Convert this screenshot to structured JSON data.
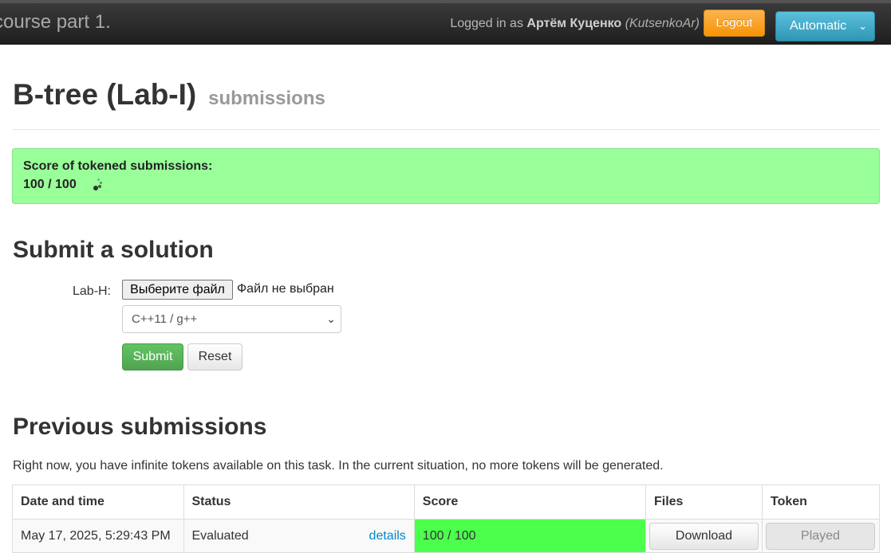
{
  "navbar": {
    "brand": "course part 1.",
    "logged_in_prefix": "Logged in as",
    "user_name": "Артём Куценко",
    "user_login": "(KutsenkoAr)",
    "logout_label": "Logout",
    "language_selector": "Automatic",
    "colors": {
      "logout": "#f89406",
      "language": "#2f96b4"
    }
  },
  "task": {
    "title": "B-tree (Lab-I)",
    "subtitle": "submissions"
  },
  "score_box": {
    "label": "Score of tokened submissions:",
    "value": "100 / 100",
    "icon": "spinner-icon",
    "color": "#99ff99"
  },
  "submit_form": {
    "heading": "Submit a solution",
    "file_field_label": "Lab-H:",
    "file_button_label": "Выберите файл",
    "file_status": "Файл не выбран",
    "language_selected": "C++11 / g++",
    "submit_label": "Submit",
    "reset_label": "Reset"
  },
  "previous": {
    "heading": "Previous submissions",
    "tokens_note": "Right now, you have infinite tokens available on this task. In the current situation, no more tokens will be generated.",
    "columns": [
      "Date and time",
      "Status",
      "Score",
      "Files",
      "Token"
    ],
    "rows": [
      {
        "datetime": "May 17, 2025, 5:29:43 PM",
        "status": "Evaluated",
        "details": "details",
        "score": "100 / 100",
        "files": "Download",
        "token": "Played"
      }
    ],
    "score_color": "#4dff4d"
  }
}
